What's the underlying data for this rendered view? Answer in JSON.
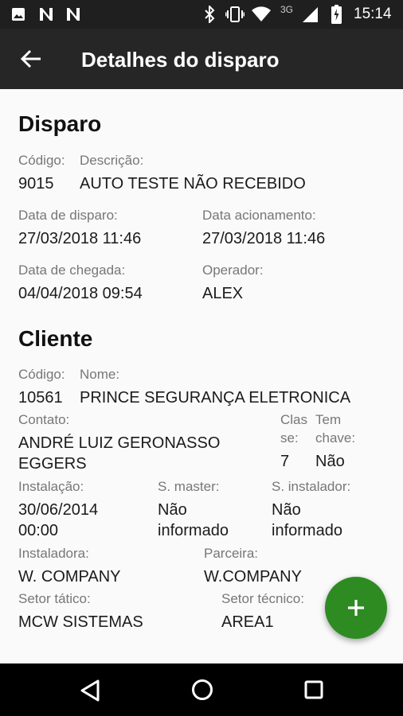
{
  "status": {
    "time": "15:14",
    "network": "3G"
  },
  "appbar": {
    "title": "Detalhes do disparo"
  },
  "disparo": {
    "section_title": "Disparo",
    "codigo_label": "Código:",
    "codigo_value": "9015",
    "descricao_label": "Descrição:",
    "descricao_value": "AUTO TESTE NÃO RECEBIDO",
    "data_disparo_label": "Data de disparo:",
    "data_disparo_value": "27/03/2018 11:46",
    "data_acionamento_label": "Data acionamento:",
    "data_acionamento_value": "27/03/2018 11:46",
    "data_chegada_label": "Data de chegada:",
    "data_chegada_value": "04/04/2018 09:54",
    "operador_label": "Operador:",
    "operador_value": "ALEX"
  },
  "cliente": {
    "section_title": "Cliente",
    "codigo_label": "Código:",
    "codigo_value": "10561",
    "nome_label": "Nome:",
    "nome_value": "PRINCE SEGURANÇA ELETRONICA",
    "contato_label": "Contato:",
    "contato_line1": "ANDRÉ LUIZ GERONASSO",
    "contato_line2": "EGGERS",
    "classe_label_1": "Clas",
    "classe_label_2": "se:",
    "classe_value": "7",
    "tem_chave_label_1": "Tem",
    "tem_chave_label_2": "chave:",
    "tem_chave_value": "Não",
    "instalacao_label": "Instalação:",
    "instalacao_line1": "30/06/2014",
    "instalacao_line2": "00:00",
    "s_master_label": "S. master:",
    "s_master_line1": "Não",
    "s_master_line2": "informado",
    "s_instalador_label": "S. instalador:",
    "s_instalador_line1": "Não",
    "s_instalador_line2": "informado",
    "instaladora_label": "Instaladora:",
    "instaladora_value": "W. COMPANY",
    "parceira_label": "Parceira:",
    "parceira_value": "W.COMPANY",
    "setor_tatico_label": "Setor tático:",
    "setor_tatico_value": "MCW SISTEMAS",
    "setor_tecnico_label": "Setor técnico:",
    "setor_tecnico_value": "AREA1"
  },
  "fab": {
    "icon": "plus-icon"
  },
  "colors": {
    "accent": "#2e8b22",
    "appbar": "#262626",
    "statusbar": "#1f1f1f"
  }
}
